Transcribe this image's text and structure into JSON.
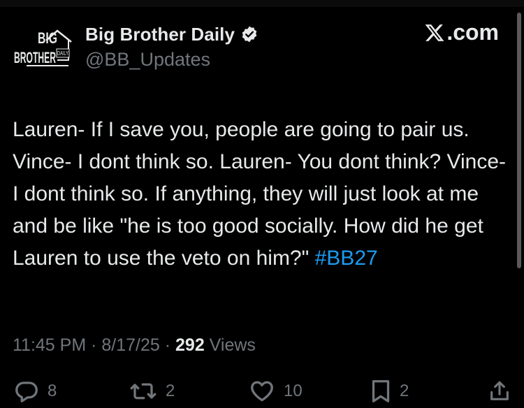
{
  "header": {
    "avatar_text_line1": "BIG",
    "avatar_text_line2": "BROTHER",
    "avatar_text_daily": "DAILY",
    "display_name": "Big Brother Daily",
    "handle": "@BB_Updates",
    "site_label": ".com",
    "verified_color": "#e7e9ea"
  },
  "tweet": {
    "text": "Lauren- If I save you, people are going to pair us. Vince- I dont think so. Lauren- You dont think? Vince- I dont think so. If anything, they will just look at me and be like \"he is too good socially. How did he get Lauren to use the veto on him?\" ",
    "hashtag": "#BB27",
    "hashtag_color": "#1d9bf0"
  },
  "meta": {
    "time": "11:45 PM",
    "separator1": " · ",
    "date": "8/17/25",
    "separator2": " · ",
    "views_count": "292",
    "views_label": " Views"
  },
  "actions": {
    "reply_count": "8",
    "retweet_count": "2",
    "like_count": "10",
    "bookmark_count": "2",
    "icons": [
      "reply-icon",
      "retweet-icon",
      "like-icon",
      "bookmark-icon",
      "share-icon"
    ],
    "icon_color": "#71767b"
  }
}
